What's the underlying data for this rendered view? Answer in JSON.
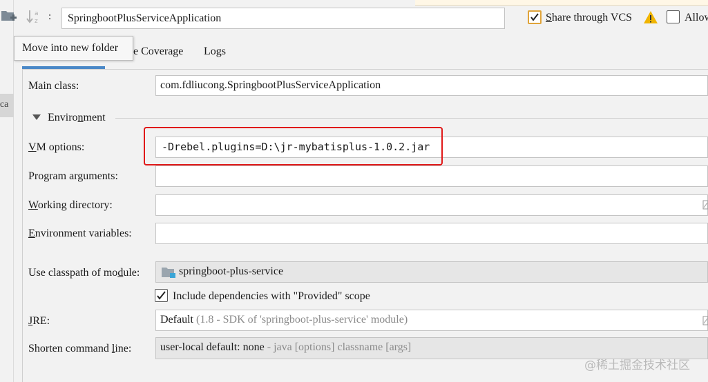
{
  "toolbar": {
    "folder_icon": "new-folder-icon",
    "sort_icon": "sort-alpha-icon",
    "name_colon": ":",
    "name_value": "SpringbootPlusServiceApplication",
    "share_label_first": "S",
    "share_label_rest": "hare through VCS",
    "share_checked": true,
    "warning_icon": "warning-icon",
    "allow_label": "Allow",
    "allow_checked": false
  },
  "tooltip": "Move into new folder",
  "left_tab_fragment": "ica",
  "tabs": {
    "coverage": "e Coverage",
    "logs": "Logs"
  },
  "form": {
    "main_class_label": "Main class:",
    "main_class_value": "com.fdliucong.SpringbootPlusServiceApplication",
    "environment_label_pre": "Enviro",
    "environment_label_u": "n",
    "environment_label_post": "ment",
    "vm_label_u": "V",
    "vm_label_rest": "M options:",
    "vm_value": "-Drebel.plugins=D:\\jr-mybatisplus-1.0.2.jar",
    "program_args_label": "Program arguments:",
    "program_args_value": "",
    "working_dir_label_u": "W",
    "working_dir_label_rest": "orking directory:",
    "working_dir_value": "",
    "env_vars_label_u": "E",
    "env_vars_label_rest": "nvironment variables:",
    "env_vars_value": "",
    "classpath_label_pre": "Use classpath of mo",
    "classpath_label_u": "d",
    "classpath_label_post": "ule:",
    "classpath_value": "springboot-plus-service",
    "include_deps_label": "Include dependencies with \"Provided\" scope",
    "include_deps_checked": true,
    "jre_label_u": "J",
    "jre_label_rest": "RE:",
    "jre_value": "Default",
    "jre_hint": "(1.8 - SDK of 'springboot-plus-service' module)",
    "shorten_label_pre": "Shorten command ",
    "shorten_label_u": "l",
    "shorten_label_post": "ine:",
    "shorten_value": "user-local default: none",
    "shorten_hint": "- java [options] classname [args]"
  },
  "watermark": "@稀土掘金技术社区",
  "colors": {
    "accent_tab": "#4a88c7",
    "highlight_box": "#e01818",
    "warning": "#f0b400",
    "share_check_border": "#e0a43a"
  }
}
